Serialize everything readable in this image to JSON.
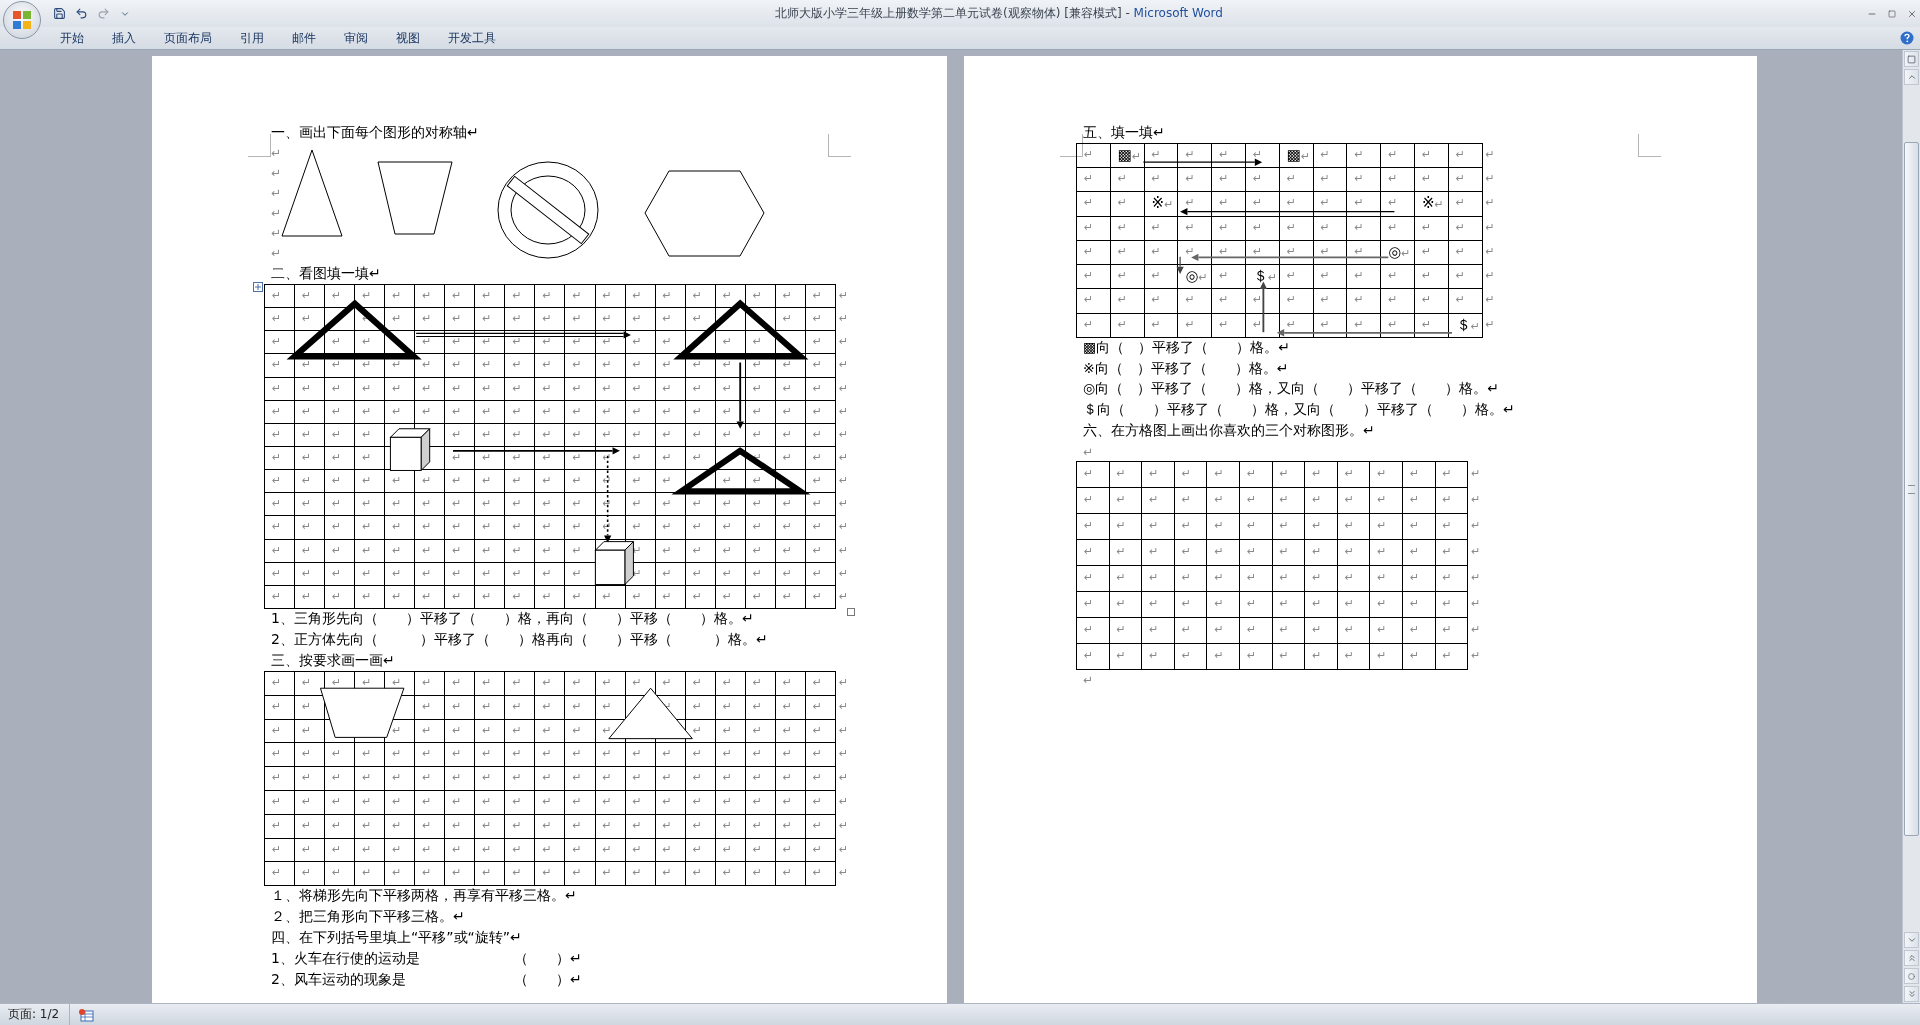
{
  "window": {
    "title": "北师大版小学三年级上册数学第二单元试卷(观察物体) [兼容模式] -",
    "app": "Microsoft Word"
  },
  "ribbon_tabs": [
    "开始",
    "插入",
    "页面布局",
    "引用",
    "邮件",
    "审阅",
    "视图",
    "开发工具"
  ],
  "left_page": {
    "blocks": [
      {
        "kind": "heading",
        "text": "一、画出下面每个图形的对称轴↵"
      },
      {
        "kind": "shapes",
        "marks": [
          "↵",
          "↵",
          "↵",
          "↵",
          "↵",
          "↵"
        ]
      },
      {
        "kind": "heading",
        "text": "二、看图填一填↵"
      },
      {
        "kind": "translation_grid",
        "handles": true,
        "rows": [
          [
            "↵",
            "↵",
            "↵",
            "↵",
            "↵",
            "↵",
            "↵",
            "↵",
            "↵",
            "↵",
            "↵",
            "↵",
            "↵",
            "↵",
            "↵",
            "↵",
            "↵",
            "↵",
            "↵",
            "↵"
          ],
          [
            "↵",
            "↵",
            null,
            "↵",
            "↵",
            "↵",
            "↵",
            "↵",
            "↵",
            "↵",
            "↵",
            "↵",
            "↵",
            "↵",
            "↵",
            null,
            null,
            "↵",
            "↵",
            "↵"
          ],
          [
            "↵",
            null,
            "↵",
            "↵",
            null,
            "↵",
            "↵",
            "↵",
            "↵",
            "↵",
            "↵",
            "↵",
            "↵",
            "↵",
            null,
            "↵",
            "↵",
            null,
            "↵",
            "↵"
          ],
          [
            "↵",
            "↵",
            "↵",
            "↵",
            "↵",
            "↵",
            "↵",
            "↵",
            "↵",
            "↵",
            "↵",
            "↵",
            "↵",
            "↵",
            "↵",
            "↵",
            "↵",
            "↵",
            "↵",
            "↵"
          ],
          [
            "↵",
            "↵",
            "↵",
            "↵",
            "↵",
            "↵",
            "↵",
            "↵",
            "↵",
            "↵",
            "↵",
            "↵",
            "↵",
            "↵",
            "↵",
            "↵",
            "↵",
            "↵",
            "↵",
            "↵"
          ],
          [
            "↵",
            "↵",
            "↵",
            "↵",
            "↵",
            "↵",
            "↵",
            "↵",
            "↵",
            "↵",
            "↵",
            "↵",
            "↵",
            "↵",
            "↵",
            "↵",
            "↵",
            "↵",
            "↵",
            "↵"
          ],
          [
            "↵",
            "↵",
            "↵",
            "↵",
            null,
            null,
            "↵",
            "↵",
            "↵",
            "↵",
            "↵",
            "↵",
            "↵",
            "↵",
            "↵",
            "↵",
            "↵",
            "↵",
            "↵",
            "↵"
          ],
          [
            "↵",
            "↵",
            "↵",
            "↵",
            null,
            null,
            "↵",
            "↵",
            "↵",
            "↵",
            "↵",
            "↵",
            "↵",
            "↵",
            "↵",
            null,
            "↵",
            "↵",
            "↵",
            "↵"
          ],
          [
            "↵",
            "↵",
            "↵",
            "↵",
            "↵",
            "↵",
            "↵",
            "↵",
            "↵",
            "↵",
            "↵",
            "↵",
            "↵",
            "↵",
            null,
            "↵",
            "↵",
            null,
            "↵",
            "↵"
          ],
          [
            "↵",
            "↵",
            "↵",
            "↵",
            "↵",
            "↵",
            "↵",
            "↵",
            "↵",
            "↵",
            "↵",
            "↵",
            "↵",
            "↵",
            "↵",
            "↵",
            "↵",
            "↵",
            "↵",
            "↵"
          ],
          [
            "↵",
            "↵",
            "↵",
            "↵",
            "↵",
            "↵",
            "↵",
            "↵",
            "↵",
            "↵",
            "↵",
            "↵",
            "↵",
            "↵",
            "↵",
            "↵",
            "↵",
            "↵",
            "↵",
            "↵"
          ],
          [
            "↵",
            "↵",
            "↵",
            "↵",
            "↵",
            "↵",
            "↵",
            "↵",
            "↵",
            "↵",
            "↵",
            null,
            "↵",
            "↵",
            "↵",
            "↵",
            "↵",
            "↵",
            "↵",
            "↵"
          ],
          [
            "↵",
            "↵",
            "↵",
            "↵",
            "↵",
            "↵",
            "↵",
            "↵",
            "↵",
            "↵",
            "↵",
            null,
            "↵",
            "↵",
            "↵",
            "↵",
            "↵",
            "↵",
            "↵",
            "↵"
          ],
          [
            "↵",
            "↵",
            "↵",
            "↵",
            "↵",
            "↵",
            "↵",
            "↵",
            "↵",
            "↵",
            "↵",
            "↵",
            "↵",
            "↵",
            "↵",
            "↵",
            "↵",
            "↵",
            "↵",
            "↵"
          ]
        ]
      },
      {
        "kind": "line",
        "text": "1、三角形先向（　　）平移了（　　）格，再向（　　）平移（　　）格。↵"
      },
      {
        "kind": "line",
        "text": "2、正方体先向（　　　）平移了（　　）格再向（　　）平移（　　　）格。↵"
      },
      {
        "kind": "heading",
        "text": "三、按要求画一画↵"
      },
      {
        "kind": "drawing_grid",
        "handles": false,
        "rows": [
          [
            "↵",
            "↵",
            "↵",
            "↵",
            "↵",
            "↵",
            "↵",
            "↵",
            "↵",
            "↵",
            "↵",
            "↵",
            "↵",
            "↵",
            "↵",
            "↵",
            "↵",
            "↵",
            "↵",
            "↵"
          ],
          [
            "↵",
            "↵",
            null,
            null,
            null,
            "↵",
            "↵",
            "↵",
            "↵",
            "↵",
            "↵",
            "↵",
            null,
            "↵",
            "↵",
            "↵",
            "↵",
            "↵",
            "↵",
            "↵"
          ],
          [
            "↵",
            "↵",
            null,
            null,
            "↵",
            "↵",
            "↵",
            "↵",
            "↵",
            "↵",
            "↵",
            "↵",
            null,
            null,
            "↵",
            "↵",
            "↵",
            "↵",
            "↵",
            "↵"
          ],
          [
            "↵",
            "↵",
            "↵",
            "↵",
            "↵",
            "↵",
            "↵",
            "↵",
            "↵",
            "↵",
            "↵",
            "↵",
            "↵",
            "↵",
            "↵",
            "↵",
            "↵",
            "↵",
            "↵",
            "↵"
          ],
          [
            "↵",
            "↵",
            "↵",
            "↵",
            "↵",
            "↵",
            "↵",
            "↵",
            "↵",
            "↵",
            "↵",
            "↵",
            "↵",
            "↵",
            "↵",
            "↵",
            "↵",
            "↵",
            "↵",
            "↵"
          ],
          [
            "↵",
            "↵",
            "↵",
            "↵",
            "↵",
            "↵",
            "↵",
            "↵",
            "↵",
            "↵",
            "↵",
            "↵",
            "↵",
            "↵",
            "↵",
            "↵",
            "↵",
            "↵",
            "↵",
            "↵"
          ],
          [
            "↵",
            "↵",
            "↵",
            "↵",
            "↵",
            "↵",
            "↵",
            "↵",
            "↵",
            "↵",
            "↵",
            "↵",
            "↵",
            "↵",
            "↵",
            "↵",
            "↵",
            "↵",
            "↵",
            "↵"
          ],
          [
            "↵",
            "↵",
            "↵",
            "↵",
            "↵",
            "↵",
            "↵",
            "↵",
            "↵",
            "↵",
            "↵",
            "↵",
            "↵",
            "↵",
            "↵",
            "↵",
            "↵",
            "↵",
            "↵",
            "↵"
          ],
          [
            "↵",
            "↵",
            "↵",
            "↵",
            "↵",
            "↵",
            "↵",
            "↵",
            "↵",
            "↵",
            "↵",
            "↵",
            "↵",
            "↵",
            "↵",
            "↵",
            "↵",
            "↵",
            "↵",
            "↵"
          ]
        ]
      },
      {
        "kind": "line",
        "text": "１、将梯形先向下平移两格，再享有平移三格。↵"
      },
      {
        "kind": "line",
        "text": "２、把三角形向下平移三格。↵"
      },
      {
        "kind": "heading",
        "text": "四、在下列括号里填上“平移”或“旋转”↵"
      },
      {
        "kind": "answer",
        "text": "1、火车在行使的运动是",
        "blank": "（　　）↵"
      },
      {
        "kind": "answer",
        "text": "2、风车运动的现象是",
        "blank": "（　　）↵"
      }
    ]
  },
  "right_page": {
    "blocks": [
      {
        "kind": "heading",
        "text": "五、填一填↵"
      },
      {
        "kind": "symbol_grid",
        "handles": false,
        "rows": [
          [
            "↵",
            {
              "symbol": "▩",
              "mark": "↵"
            },
            "↵",
            "↵",
            "↵",
            "↵",
            {
              "symbol": "▩",
              "mark": "↵"
            },
            "↵",
            "↵",
            "↵",
            "↵",
            "↵",
            "↵"
          ],
          [
            "↵",
            "↵",
            "↵",
            "↵",
            "↵",
            "↵",
            "↵",
            "↵",
            "↵",
            "↵",
            "↵",
            "↵",
            "↵"
          ],
          [
            "↵",
            "↵",
            {
              "symbol": "※",
              "mark": "↵"
            },
            "↵",
            "↵",
            "↵",
            "↵",
            "↵",
            "↵",
            "↵",
            {
              "symbol": "※",
              "mark": "↵"
            },
            "↵",
            "↵"
          ],
          [
            "↵",
            "↵",
            "↵",
            "↵",
            "↵",
            "↵",
            "↵",
            "↵",
            "↵",
            "↵",
            "↵",
            "↵",
            "↵"
          ],
          [
            "↵",
            "↵",
            "↵",
            "↵",
            "↵",
            "↵",
            "↵",
            "↵",
            "↵",
            {
              "symbol": "◎",
              "mark": "↵"
            },
            "↵",
            "↵",
            "↵"
          ],
          [
            "↵",
            "↵",
            "↵",
            {
              "symbol": "◎",
              "mark": "↵"
            },
            "↵",
            {
              "symbol": "＄",
              "mark": "↵"
            },
            "↵",
            "↵",
            "↵",
            "↵",
            "↵",
            "↵",
            "↵"
          ],
          [
            "↵",
            "↵",
            "↵",
            "↵",
            "↵",
            "↵",
            "↵",
            "↵",
            "↵",
            "↵",
            "↵",
            "↵",
            "↵"
          ],
          [
            "↵",
            "↵",
            "↵",
            "↵",
            "↵",
            "↵",
            "↵",
            "↵",
            "↵",
            "↵",
            "↵",
            {
              "symbol": "＄",
              "mark": "↵"
            },
            "↵"
          ]
        ]
      },
      {
        "kind": "line",
        "text": "▩向（　）平移了（　　）格。↵"
      },
      {
        "kind": "line",
        "text": "※向（　）平移了（　　）格。↵"
      },
      {
        "kind": "line",
        "text": "◎向（　）平移了（　　）格，又向（　　）平移了（　　）格。↵"
      },
      {
        "kind": "line",
        "text": "＄向（　　）平移了（　　）格，又向（　　）平移了（　　）格。↵"
      },
      {
        "kind": "heading",
        "text": "六、在方格图上画出你喜欢的三个对称图形。↵"
      },
      {
        "kind": "mark",
        "text": "↵"
      },
      {
        "kind": "blank_grid",
        "handles": false,
        "rows": [
          [
            "↵",
            "↵",
            "↵",
            "↵",
            "↵",
            "↵",
            "↵",
            "↵",
            "↵",
            "↵",
            "↵",
            "↵",
            "↵"
          ],
          [
            "↵",
            "↵",
            "↵",
            "↵",
            "↵",
            "↵",
            "↵",
            "↵",
            "↵",
            "↵",
            "↵",
            "↵",
            "↵"
          ],
          [
            "↵",
            "↵",
            "↵",
            "↵",
            "↵",
            "↵",
            "↵",
            "↵",
            "↵",
            "↵",
            "↵",
            "↵",
            "↵"
          ],
          [
            "↵",
            "↵",
            "↵",
            "↵",
            "↵",
            "↵",
            "↵",
            "↵",
            "↵",
            "↵",
            "↵",
            "↵",
            "↵"
          ],
          [
            "↵",
            "↵",
            "↵",
            "↵",
            "↵",
            "↵",
            "↵",
            "↵",
            "↵",
            "↵",
            "↵",
            "↵",
            "↵"
          ],
          [
            "↵",
            "↵",
            "↵",
            "↵",
            "↵",
            "↵",
            "↵",
            "↵",
            "↵",
            "↵",
            "↵",
            "↵",
            "↵"
          ],
          [
            "↵",
            "↵",
            "↵",
            "↵",
            "↵",
            "↵",
            "↵",
            "↵",
            "↵",
            "↵",
            "↵",
            "↵",
            "↵"
          ],
          [
            "↵",
            "↵",
            "↵",
            "↵",
            "↵",
            "↵",
            "↵",
            "↵",
            "↵",
            "↵",
            "↵",
            "↵",
            "↵"
          ]
        ]
      },
      {
        "kind": "mark",
        "text": "↵"
      }
    ]
  },
  "status_bar": {
    "page": "页面: 1/2"
  }
}
